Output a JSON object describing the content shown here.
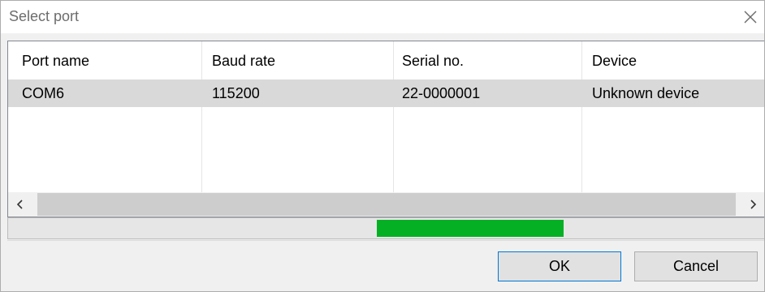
{
  "window": {
    "title": "Select port",
    "close_icon": "close-icon"
  },
  "table": {
    "columns": [
      "Port name",
      "Baud rate",
      "Serial no.",
      "Device"
    ],
    "rows": [
      [
        "COM6",
        "115200",
        "22-0000001",
        "Unknown device"
      ]
    ],
    "selected_row": 0
  },
  "scrollbar": {
    "left_icon": "chevron-left-icon",
    "right_icon": "chevron-right-icon"
  },
  "progress": {
    "start_fraction": 0.488,
    "end_fraction": 0.735,
    "color": "#06b025"
  },
  "buttons": {
    "ok_label": "OK",
    "cancel_label": "Cancel"
  },
  "colors": {
    "selection": "#d9d9d9",
    "default_button_border": "#0078d7"
  }
}
